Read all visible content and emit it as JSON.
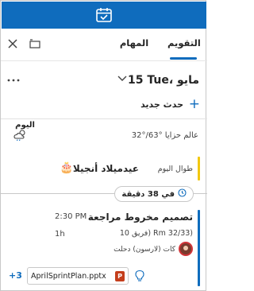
{
  "header": {
    "icon": "calendar-icon",
    "accent_color": "#0f6cbd"
  },
  "tabs": [
    {
      "label": "التقويم",
      "selected": true
    },
    {
      "label": "المهام",
      "selected": false
    }
  ],
  "toolbar": {
    "close_icon": "close-icon",
    "popout_icon": "popout-icon"
  },
  "date_nav": {
    "date": "15 Tue، مايو",
    "chevron_icon": "chevron-down-icon",
    "more_icon": "more-icon"
  },
  "new_event": {
    "label": "حدث جديد",
    "icon": "plus-icon"
  },
  "today_label": "اليوم",
  "weather": {
    "text": "32°/63° عالم حزايا",
    "icon": "weather-icon"
  },
  "birthday": {
    "allday": "طوال اليوم",
    "name": "عيدميلاد أنجيلا",
    "icon": "cake-icon",
    "color": "#f2c811"
  },
  "timer": {
    "label": "في 38 دقيقة",
    "icon": "clock-icon"
  },
  "event": {
    "time": "2:30 PM",
    "duration": "1h",
    "title": "تصميم مخروط مراجعة",
    "location": "فريق 10) Rm 32/33)",
    "organizer": "كات (لارسون) دحلت",
    "color": "#0f6cbd"
  },
  "attachments": {
    "more": "+3",
    "file_name": "AprilSprintPlan.pptx",
    "file_icon": "powerpoint-icon",
    "bulb_icon": "lightbulb-icon"
  }
}
